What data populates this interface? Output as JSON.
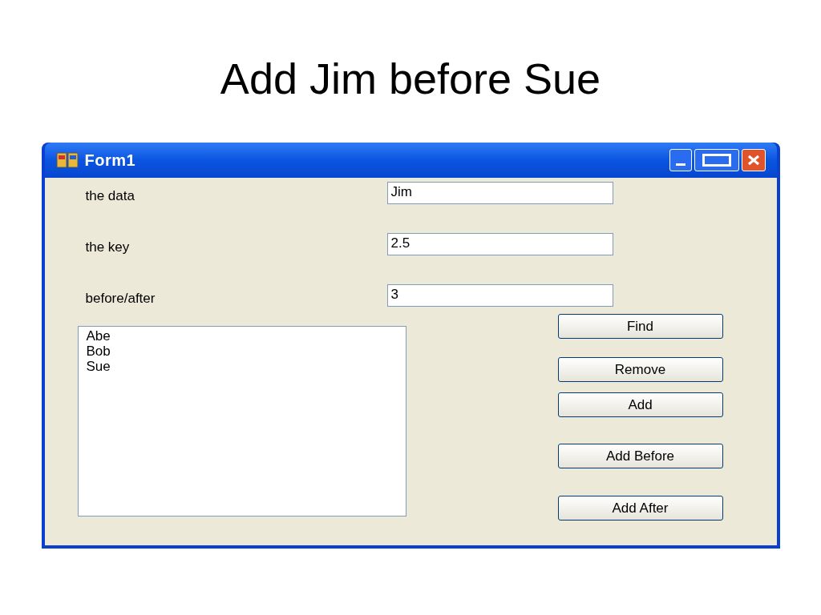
{
  "slide_title": "Add Jim before Sue",
  "window": {
    "title": "Form1"
  },
  "fields": [
    {
      "label": "the data",
      "value": "Jim"
    },
    {
      "label": "the key",
      "value": "2.5"
    },
    {
      "label": "before/after",
      "value": "3"
    }
  ],
  "list_items": [
    "Abe",
    "Bob",
    "Sue"
  ],
  "buttons": [
    "Find",
    "Remove",
    "Add",
    "Add Before",
    "Add After"
  ]
}
